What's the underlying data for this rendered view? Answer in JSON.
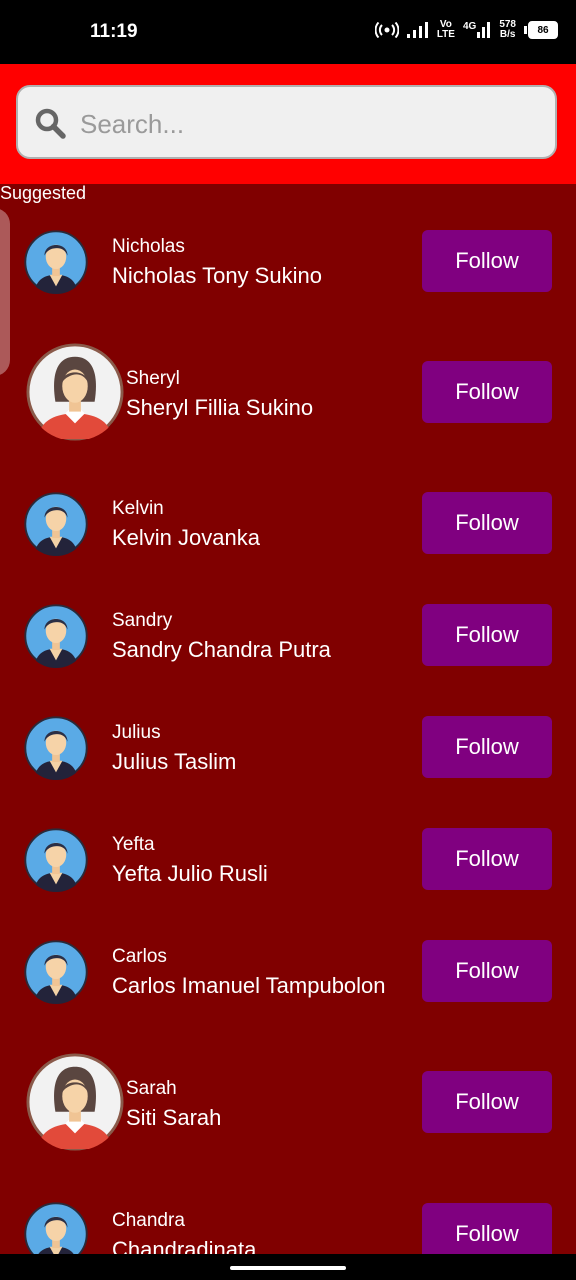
{
  "status_bar": {
    "time": "11:19",
    "network_speed_top": "578",
    "network_speed_bottom": "B/s",
    "volte_top": "Vo",
    "volte_bottom": "LTE",
    "network_type": "4G",
    "battery": "86"
  },
  "search": {
    "placeholder": "Search..."
  },
  "section": {
    "label": "Suggested"
  },
  "users": [
    {
      "short": "Nicholas",
      "full": "Nicholas Tony Sukino",
      "avatar": "male-avatar-icon",
      "follow_label": "Follow"
    },
    {
      "short": "Sheryl",
      "full": "Sheryl Fillia Sukino",
      "avatar": "female-avatar-icon",
      "follow_label": "Follow"
    },
    {
      "short": "Kelvin",
      "full": "Kelvin Jovanka",
      "avatar": "male-avatar-icon",
      "follow_label": "Follow"
    },
    {
      "short": "Sandry",
      "full": "Sandry Chandra Putra",
      "avatar": "male-avatar-icon",
      "follow_label": "Follow"
    },
    {
      "short": "Julius",
      "full": "Julius Taslim",
      "avatar": "male-avatar-icon",
      "follow_label": "Follow"
    },
    {
      "short": "Yefta",
      "full": "Yefta Julio Rusli",
      "avatar": "male-avatar-icon",
      "follow_label": "Follow"
    },
    {
      "short": "Carlos",
      "full": "Carlos Imanuel Tampubolon",
      "avatar": "male-avatar-icon",
      "follow_label": "Follow"
    },
    {
      "short": "Sarah",
      "full": "Siti Sarah",
      "avatar": "female-avatar-icon",
      "follow_label": "Follow"
    },
    {
      "short": "Chandra",
      "full": "Chandradinata",
      "avatar": "male-avatar-icon",
      "follow_label": "Follow"
    }
  ],
  "colors": {
    "background": "#800000",
    "header": "#ff0000",
    "follow_button": "#800080"
  }
}
